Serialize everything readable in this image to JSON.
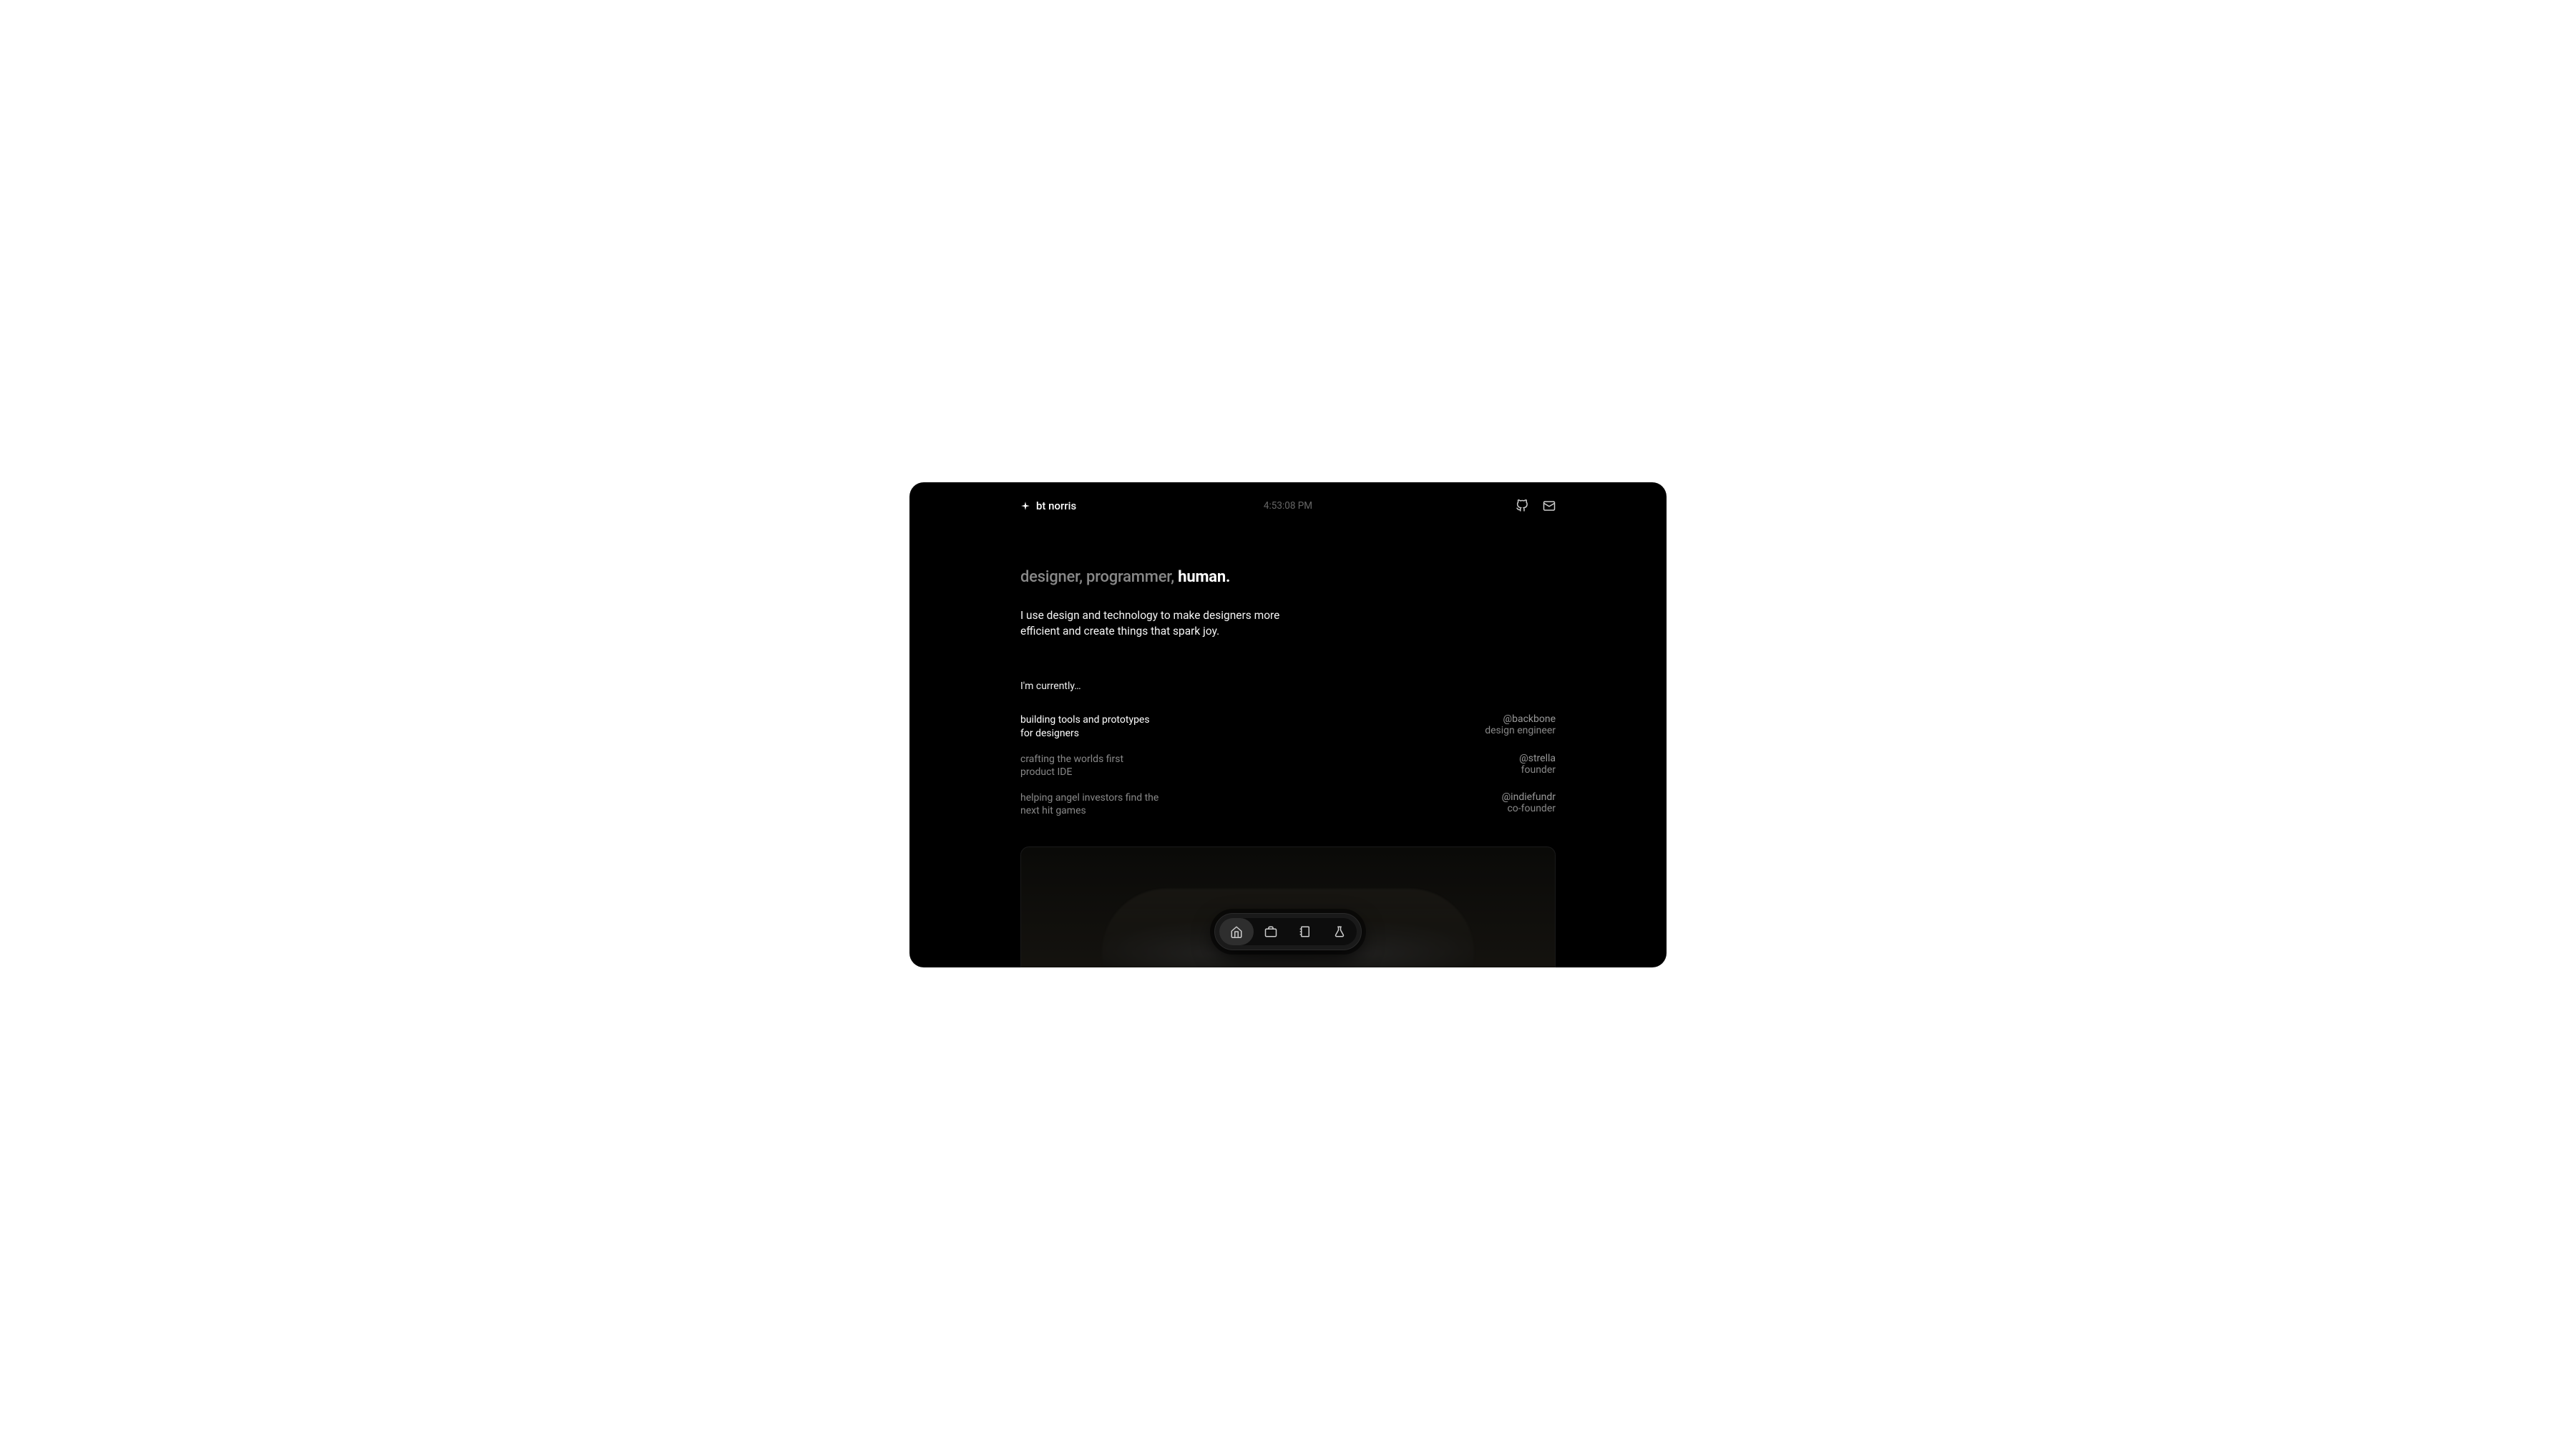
{
  "header": {
    "brand": "bt norris",
    "clock": "4:53:08 PM"
  },
  "hero": {
    "headline_muted": "designer, programmer, ",
    "headline_bold": "human.",
    "subhead": "I use design and technology to make designers more efficient and create things that spark joy."
  },
  "current": {
    "label": "I'm currently…",
    "roles": [
      {
        "desc_l1": "building tools and prototypes",
        "desc_l2": "for designers",
        "company": "@backbone",
        "title": "design engineer",
        "active": true
      },
      {
        "desc_l1": "crafting the worlds first",
        "desc_l2": "product IDE",
        "company": "@strella",
        "title": "founder",
        "active": false
      },
      {
        "desc_l1": "helping angel investors find the",
        "desc_l2": "next hit games",
        "company": "@indiefundr",
        "title": "co-founder",
        "active": false
      }
    ]
  },
  "dock": {
    "items": [
      {
        "name": "home",
        "active": true
      },
      {
        "name": "work",
        "active": false
      },
      {
        "name": "notes",
        "active": false
      },
      {
        "name": "lab",
        "active": false
      }
    ]
  }
}
